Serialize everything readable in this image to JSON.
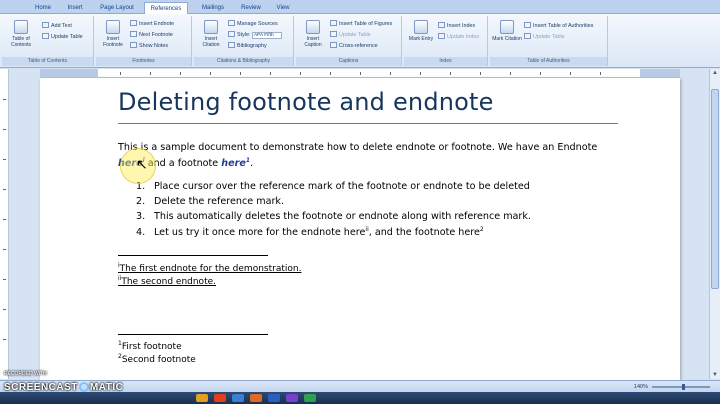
{
  "ribbon": {
    "tabs": [
      "Home",
      "Insert",
      "Page Layout",
      "References",
      "Mailings",
      "Review",
      "View"
    ],
    "active_tab": "References",
    "groups": {
      "toc": {
        "label": "Table of Contents",
        "toc_button": "Table of Contents",
        "add_text": "Add Text",
        "update_table": "Update Table"
      },
      "footnotes": {
        "label": "Footnotes",
        "insert_footnote": "Insert Footnote",
        "insert_endnote": "Insert Endnote",
        "next_footnote": "Next Footnote",
        "show_notes": "Show Notes"
      },
      "citations": {
        "label": "Citations & Bibliography",
        "insert_citation": "Insert Citation",
        "manage_sources": "Manage Sources",
        "style_label": "Style:",
        "style_value": "APA Fifth",
        "bibliography": "Bibliography"
      },
      "captions": {
        "label": "Captions",
        "insert_caption": "Insert Caption",
        "insert_table_of_figures": "Insert Table of Figures",
        "update_table": "Update Table",
        "cross_reference": "Cross-reference"
      },
      "index": {
        "label": "Index",
        "mark_entry": "Mark Entry",
        "insert_index": "Insert Index",
        "update_index": "Update Index"
      },
      "toa": {
        "label": "Table of Authorities",
        "mark_citation": "Mark Citation",
        "insert_toa": "Insert Table of Authorities",
        "update_table": "Update Table"
      }
    }
  },
  "document": {
    "title": "Deleting footnote and endnote",
    "intro_line1": "This is a sample document to demonstrate how to delete endnote or footnote. We have an Endnote",
    "intro_ref1": "here",
    "intro_ref1_mark": "i",
    "intro_mid": " and a footnote ",
    "intro_ref2": "here",
    "intro_ref2_mark": "1",
    "intro_end": ".",
    "steps": [
      {
        "num": "1.",
        "text": "Place cursor over the reference mark of the footnote or endnote to be deleted"
      },
      {
        "num": "2.",
        "text": "Delete the reference mark."
      },
      {
        "num": "3.",
        "text": "This automatically deletes the footnote or endnote along with reference mark."
      },
      {
        "num": "4.",
        "text": "Let us try it once more for the endnote here",
        "mark1": "ii",
        "mid": ", and the footnote here",
        "mark2": "2"
      }
    ],
    "endnotes": [
      {
        "mark": "i",
        "text": "The first endnote for the demonstration."
      },
      {
        "mark": "ii",
        "text": "The second endnote."
      }
    ],
    "footnotes": [
      {
        "mark": "1",
        "text": "First footnote"
      },
      {
        "mark": "2",
        "text": "Second footnote"
      }
    ]
  },
  "statusbar": {
    "zoom": "140%"
  },
  "watermark": {
    "top": "RECORDED WITH",
    "brand_left": "SCREENCAST",
    "brand_right": "MATIC"
  },
  "colors": {
    "title": "#17365d",
    "title_rule": "#4f81bd",
    "reference_link": "#1f3c99",
    "ribbon_bg": "#dbe7f6"
  }
}
